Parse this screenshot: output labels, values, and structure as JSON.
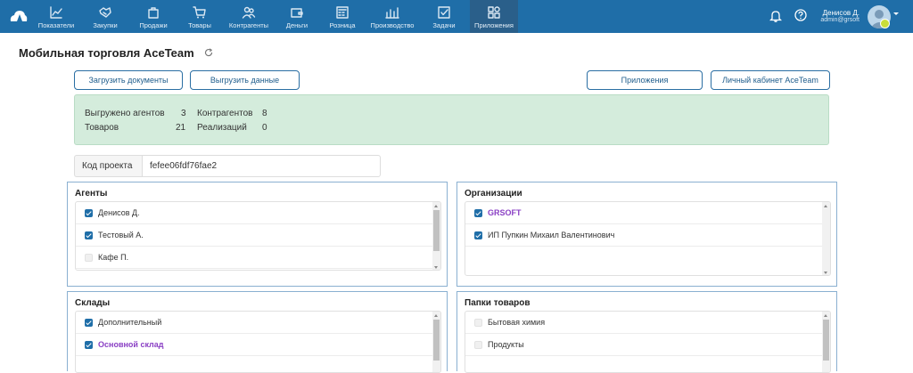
{
  "nav": {
    "items": [
      {
        "label": "Показатели",
        "icon": "chart-line-icon"
      },
      {
        "label": "Закупки",
        "icon": "handshake-icon"
      },
      {
        "label": "Продажи",
        "icon": "bag-icon"
      },
      {
        "label": "Товары",
        "icon": "cart-icon"
      },
      {
        "label": "Контрагенты",
        "icon": "people-icon"
      },
      {
        "label": "Деньги",
        "icon": "wallet-icon"
      },
      {
        "label": "Розница",
        "icon": "cash-register-icon"
      },
      {
        "label": "Производство",
        "icon": "factory-icon"
      },
      {
        "label": "Задачи",
        "icon": "checkbox-icon"
      },
      {
        "label": "Приложения",
        "icon": "apps-grid-icon"
      }
    ],
    "active": "Приложения"
  },
  "user": {
    "name": "Денисов Д.",
    "email": "admin@grsoft"
  },
  "page": {
    "title": "Мобильная торговля AceTeam"
  },
  "buttons": {
    "upload": "Загрузить документы",
    "download": "Выгрузить данные",
    "apps": "Приложения",
    "cabinet": "Личный кабинет AceTeam"
  },
  "stats": {
    "agents_label": "Выгружено агентов",
    "agents_value": "3",
    "contractors_label": "Контрагентов",
    "contractors_value": "8",
    "goods_label": "Товаров",
    "goods_value": "21",
    "sales_label": "Реализаций",
    "sales_value": "0"
  },
  "project": {
    "label": "Код проекта",
    "value": "fefee06fdf76fae2"
  },
  "panels": {
    "agents": {
      "title": "Агенты",
      "items": [
        {
          "label": "Денисов Д.",
          "checked": true
        },
        {
          "label": "Тестовый А.",
          "checked": true
        },
        {
          "label": "Кафе П.",
          "checked": false
        }
      ]
    },
    "orgs": {
      "title": "Организации",
      "items": [
        {
          "label": "GRSOFT",
          "checked": true
        },
        {
          "label": "ИП Пупкин Михаил Валентинович",
          "checked": true
        }
      ]
    },
    "warehouses": {
      "title": "Склады",
      "items": [
        {
          "label": "Дополнительный",
          "checked": true
        },
        {
          "label": "Основной склад",
          "checked": true
        }
      ]
    },
    "folders": {
      "title": "Папки товаров",
      "items": [
        {
          "label": "Бытовая химия",
          "checked": false
        },
        {
          "label": "Продукты",
          "checked": false
        }
      ]
    }
  },
  "colors": {
    "navbar": "#1f6ea8",
    "accent": "#8a3fc4",
    "stats_bg": "#d4ecdc"
  }
}
